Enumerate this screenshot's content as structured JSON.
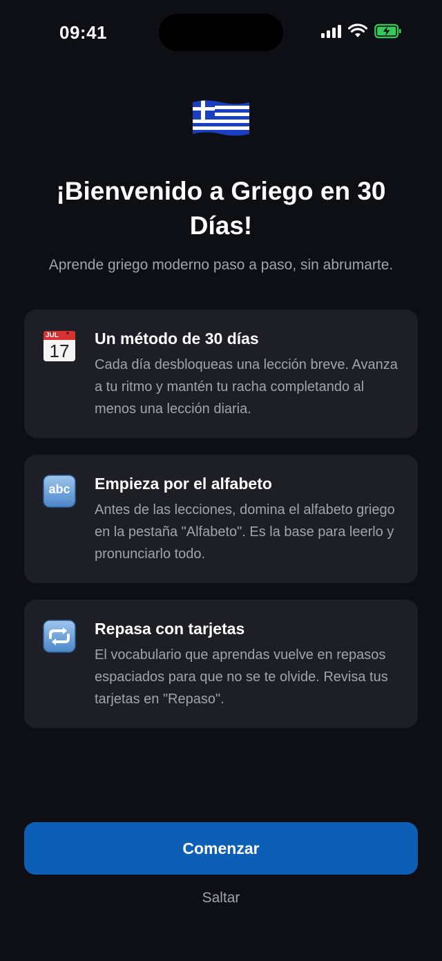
{
  "status_bar": {
    "time": "09:41",
    "icons": [
      "cellular-signal-icon",
      "wifi-icon",
      "battery-charging-icon"
    ]
  },
  "header": {
    "flag_icon": "greece-flag-icon",
    "title": "¡Bienvenido a Griego en 30 Días!",
    "subtitle": "Aprende griego moderno paso a paso, sin abrumarte."
  },
  "cards": [
    {
      "icon": "calendar-icon",
      "icon_month": "JUL",
      "icon_day": "17",
      "title": "Un método de 30 días",
      "body": "Cada día desbloqueas una lección breve. Avanza a tu ritmo y mantén tu racha completando al menos una lección diaria."
    },
    {
      "icon": "abc-icon",
      "icon_text": "abc",
      "title": "Empieza por el alfabeto",
      "body": "Antes de las lecciones, domina el alfabeto griego en la pestaña \"Alfabeto\". Es la base para leerlo y pronunciarlo todo."
    },
    {
      "icon": "repeat-icon",
      "title": "Repasa con tarjetas",
      "body": "El vocabulario que aprendas vuelve en repasos espaciados para que no se te olvide. Revisa tus tarjetas en \"Repaso\"."
    }
  ],
  "actions": {
    "primary_label": "Comenzar",
    "skip_label": "Saltar"
  },
  "colors": {
    "background": "#0e0f14",
    "card": "#1d1e26",
    "accent": "#0c5fb4",
    "secondary_text": "#a2a4ab"
  }
}
